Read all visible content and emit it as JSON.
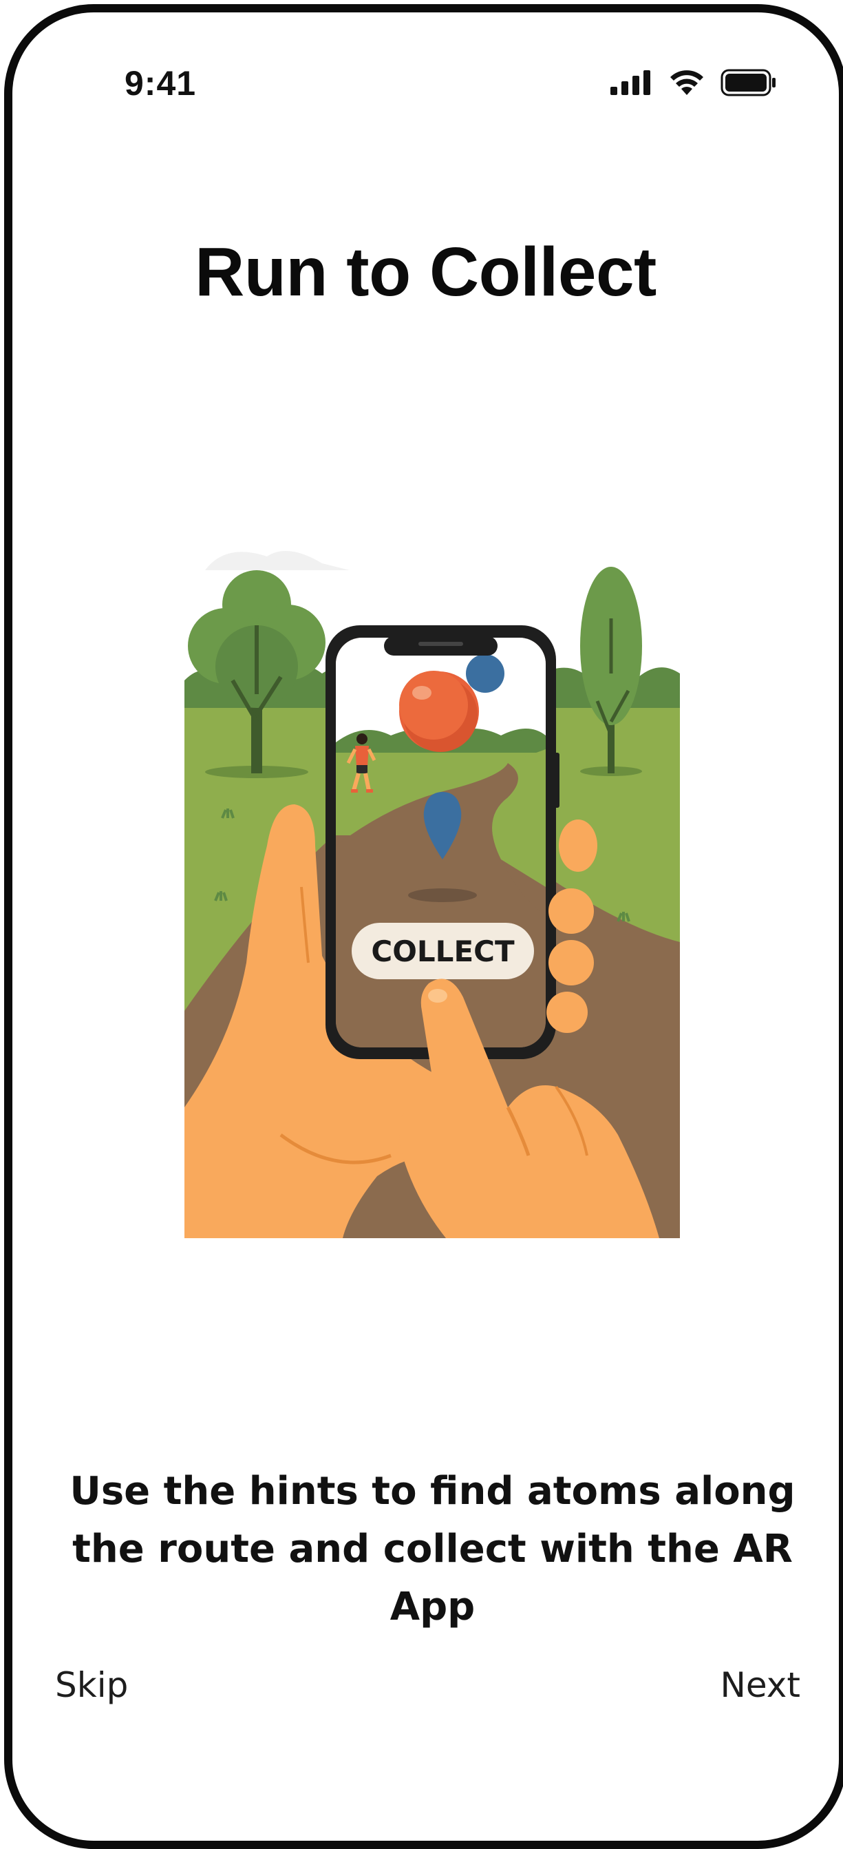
{
  "status_bar": {
    "time": "9:41",
    "icons": [
      "cellular-signal-icon",
      "wifi-icon",
      "battery-icon"
    ]
  },
  "onboarding": {
    "title": "Run to Collect",
    "description": "Use the hints to find atoms along the route and collect with the AR App",
    "illustration": {
      "button_label": "COLLECT"
    }
  },
  "navigation": {
    "skip_label": "Skip",
    "next_label": "Next"
  },
  "colors": {
    "text": "#111111",
    "frame": "#0b0b0b",
    "grass": "#8fae4d",
    "path": "#8b6b4e",
    "skin": "#f9a95c",
    "atom_orange": "#e8613a",
    "marker_blue": "#3b6fa0",
    "button_bg": "#f3ebdf"
  }
}
